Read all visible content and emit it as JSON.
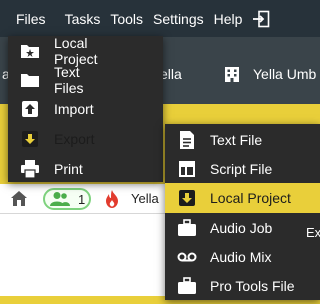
{
  "menubar": {
    "items": [
      "Files",
      "Tasks",
      "Tools",
      "Settings",
      "Help"
    ],
    "exit_icon": "exit-icon"
  },
  "header": {
    "left_text": "ella",
    "right_text": "Yella Umb",
    "left_partial": "a"
  },
  "toolbar": {
    "users_count": "1",
    "user_label": "Yella"
  },
  "files_menu": {
    "items": [
      {
        "label": "Local Project",
        "icon": "project-folder-icon",
        "submenu": true
      },
      {
        "label": "Text Files",
        "icon": "folder-icon",
        "submenu": true
      },
      {
        "label": "Import",
        "icon": "import-icon",
        "submenu": true
      },
      {
        "label": "Export",
        "icon": "export-icon",
        "submenu": true,
        "active": true
      },
      {
        "label": "Print",
        "icon": "printer-icon",
        "submenu": false
      }
    ]
  },
  "export_submenu": {
    "items": [
      {
        "label": "Text File",
        "icon": "text-file-icon"
      },
      {
        "label": "Script File",
        "icon": "script-file-icon"
      },
      {
        "label": "Local Project",
        "icon": "local-project-icon",
        "active": true
      },
      {
        "label": "Audio Job",
        "icon": "briefcase-icon"
      },
      {
        "label": "Audio Mix",
        "icon": "audio-mix-icon"
      },
      {
        "label": "Pro Tools File",
        "icon": "briefcase-icon"
      }
    ]
  },
  "tooltip": {
    "text": "Ex"
  },
  "colors": {
    "menubar": "#27323a",
    "menu_bg": "#2b2b2b",
    "accent_yellow": "#e9cf3a",
    "badge_green": "#7ed27e",
    "fire_red": "#e23b2e"
  }
}
